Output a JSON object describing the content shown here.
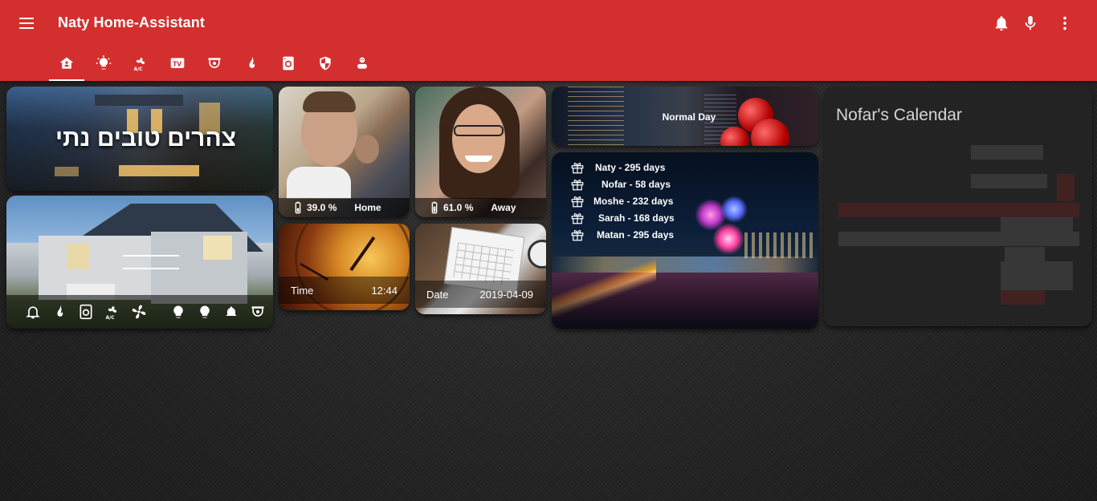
{
  "app": {
    "title": "Naty Home-Assistant"
  },
  "header": {
    "menu_icon": "menu-icon",
    "right_icons": [
      "bell-icon",
      "microphone-icon",
      "more-vert-icon"
    ]
  },
  "tabs": [
    {
      "icon": "home-icon",
      "active": true
    },
    {
      "icon": "lightbulb-icon"
    },
    {
      "icon": "air-conditioner-icon"
    },
    {
      "icon": "tv-icon"
    },
    {
      "icon": "camera-dome-icon"
    },
    {
      "icon": "fire-icon"
    },
    {
      "icon": "washing-machine-icon"
    },
    {
      "icon": "shield-icon"
    },
    {
      "icon": "robot-vacuum-icon"
    }
  ],
  "greeting": {
    "text": "צהרים טובים נתי"
  },
  "house_status_icons": [
    "bell-icon",
    "fire-icon",
    "washing-machine-icon",
    "air-conditioner-icon",
    "fan-icon",
    "lightbulb-icon",
    "lightbulb-icon",
    "bell-ring-icon",
    "camera-dome-icon"
  ],
  "person1": {
    "battery": "39.0 %",
    "status": "Home"
  },
  "person2": {
    "battery": "61.0 %",
    "status": "Away"
  },
  "time_card": {
    "label": "Time",
    "value": "12:44"
  },
  "date_card": {
    "label": "Date",
    "value": "2019-04-09"
  },
  "day_card": {
    "text": "Normal Day"
  },
  "birthdays": [
    {
      "text": "Naty - 295 days"
    },
    {
      "text": "Nofar - 58 days"
    },
    {
      "text": "Moshe - 232 days"
    },
    {
      "text": "Sarah - 168 days"
    },
    {
      "text": "Matan - 295 days"
    }
  ],
  "calendar": {
    "title": "Nofar's Calendar"
  },
  "colors": {
    "header": "#d32f2f",
    "card_dark": "#232323"
  }
}
